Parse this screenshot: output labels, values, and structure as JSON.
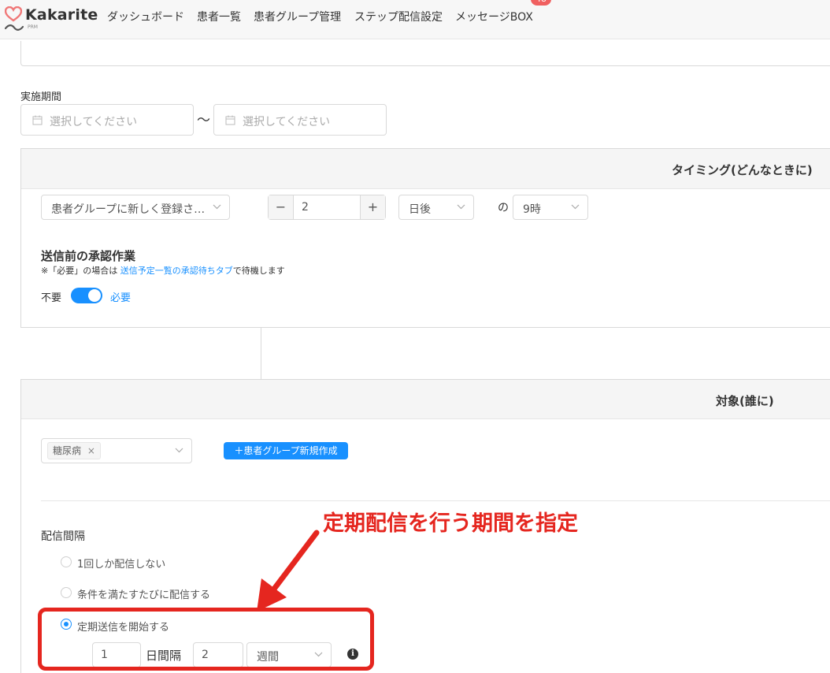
{
  "app": {
    "logo_text": "Kakarite",
    "logo_sub": "PRM"
  },
  "nav": {
    "items": [
      "ダッシュボード",
      "患者一覧",
      "患者グループ管理",
      "ステップ配信設定",
      "メッセージBOX"
    ],
    "badge_count": "48"
  },
  "period": {
    "label": "実施期間",
    "start_placeholder": "選択してください",
    "separator": "〜",
    "end_placeholder": "選択してください"
  },
  "timing": {
    "title": "タイミング(どんなときに)",
    "trigger_value": "患者グループに新しく登録さ…",
    "offset_value": "2",
    "offset_unit": "日後",
    "of_label": "の",
    "time_value": "9時",
    "approval_title": "送信前の承認作業",
    "approval_note_prefix": "※「必要」の場合は",
    "approval_note_link": "送信予定一覧の承認待ちタブ",
    "approval_note_suffix": "で待機します",
    "toggle_off_label": "不要",
    "toggle_on_label": "必要"
  },
  "target": {
    "title": "対象(誰に)",
    "selected_tag": "糖尿病",
    "create_group_label": "患者グループ新規作成"
  },
  "annotation": {
    "text": "定期配信を行う期間を指定"
  },
  "interval": {
    "label": "配信間隔",
    "options": [
      "1回しか配信しない",
      "条件を満たすたびに配信する",
      "定期送信を開始する"
    ],
    "selected_index": 2,
    "start_value": "1",
    "interval_label": "日間隔",
    "count_value": "2",
    "unit_value": "週間"
  },
  "colors": {
    "accent": "#1890ff",
    "annotation_red": "#e5261f",
    "logo_heart": "#f07878",
    "badge": "#f06060"
  }
}
